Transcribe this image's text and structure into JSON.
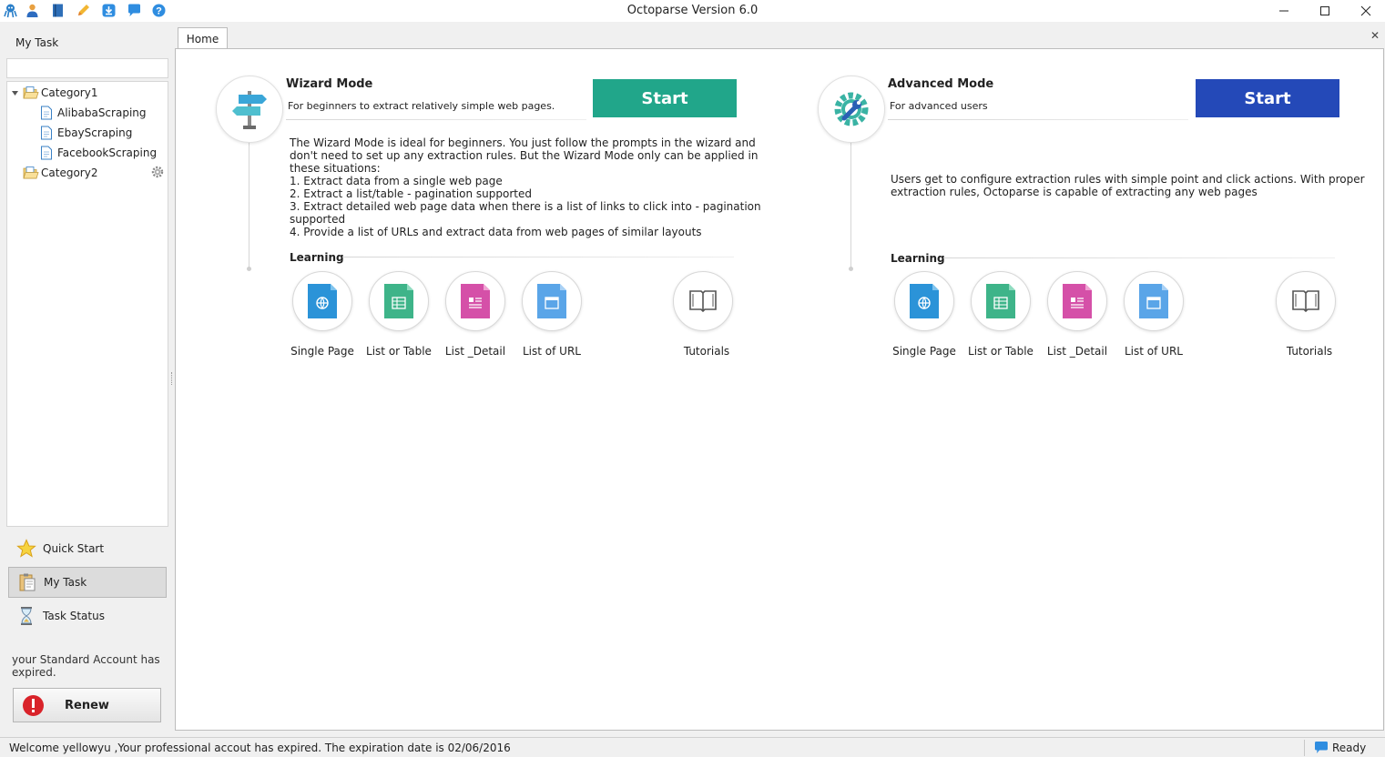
{
  "window": {
    "title": "Octoparse Version 6.0"
  },
  "quick_access_icons": [
    "octopus-icon",
    "user-icon",
    "book-icon",
    "pencil-icon",
    "download-icon",
    "chat-icon",
    "help-icon"
  ],
  "sidebar": {
    "title": "My Task",
    "search_placeholder": "",
    "tree": [
      {
        "label": "Category1",
        "type": "folder",
        "expanded": true
      },
      {
        "label": "AlibabaScraping",
        "type": "task"
      },
      {
        "label": "EbayScraping",
        "type": "task"
      },
      {
        "label": "FacebookScraping",
        "type": "task"
      },
      {
        "label": "Category2",
        "type": "folder",
        "expanded": false
      }
    ],
    "nav": [
      {
        "label": "Quick Start",
        "icon": "star-icon"
      },
      {
        "label": "My Task",
        "icon": "clipboard-icon",
        "active": true
      },
      {
        "label": "Task Status",
        "icon": "hourglass-icon"
      }
    ],
    "expired_msg": "your Standard Account has expired.",
    "renew_label": "Renew"
  },
  "tabs": [
    {
      "label": "Home"
    }
  ],
  "wizard": {
    "title": "Wizard Mode",
    "subtitle": "For beginners to extract relatively simple web pages.",
    "start_label": "Start",
    "start_color": "#21a68a",
    "desc": [
      "The Wizard Mode is ideal for beginners. You just follow the prompts in the wizard and",
      "don't need to set up any extraction rules. But the Wizard Mode only can be applied in",
      "these situations:",
      "1. Extract data from a single web page",
      "2. Extract a list/table - pagination supported",
      "3. Extract detailed web page data when there is a list of links to click into - pagination",
      "supported",
      "4. Provide a list of URLs and extract data from web pages of similar layouts"
    ],
    "learning_label": "Learning",
    "learning_items": [
      {
        "label": "Single Page",
        "icon": "globe-doc-icon",
        "color": "#2b93d8"
      },
      {
        "label": "List or Table",
        "icon": "table-doc-icon",
        "color": "#3eb489"
      },
      {
        "label": "List _Detail",
        "icon": "detail-doc-icon",
        "color": "#d550a8"
      },
      {
        "label": "List of URL",
        "icon": "url-doc-icon",
        "color": "#5aa5e8"
      },
      {
        "label": "Tutorials",
        "icon": "open-book-icon",
        "color": "#555555"
      }
    ]
  },
  "advanced": {
    "title": "Advanced Mode",
    "subtitle": "For advanced users",
    "start_label": "Start",
    "start_color": "#2449b8",
    "desc": [
      "Users get to configure extraction rules with simple point and click actions. With proper",
      "extraction rules, Octoparse is capable of extracting any web pages"
    ],
    "learning_label": "Learning",
    "learning_items": [
      {
        "label": "Single Page",
        "icon": "globe-doc-icon",
        "color": "#2b93d8"
      },
      {
        "label": "List or Table",
        "icon": "table-doc-icon",
        "color": "#3eb489"
      },
      {
        "label": "List _Detail",
        "icon": "detail-doc-icon",
        "color": "#d550a8"
      },
      {
        "label": "List of URL",
        "icon": "url-doc-icon",
        "color": "#5aa5e8"
      },
      {
        "label": "Tutorials",
        "icon": "open-book-icon",
        "color": "#555555"
      }
    ]
  },
  "statusbar": {
    "welcome": "Welcome  yellowyu ,Your professional accout has expired. The expiration date is 02/06/2016",
    "ready": "Ready"
  }
}
